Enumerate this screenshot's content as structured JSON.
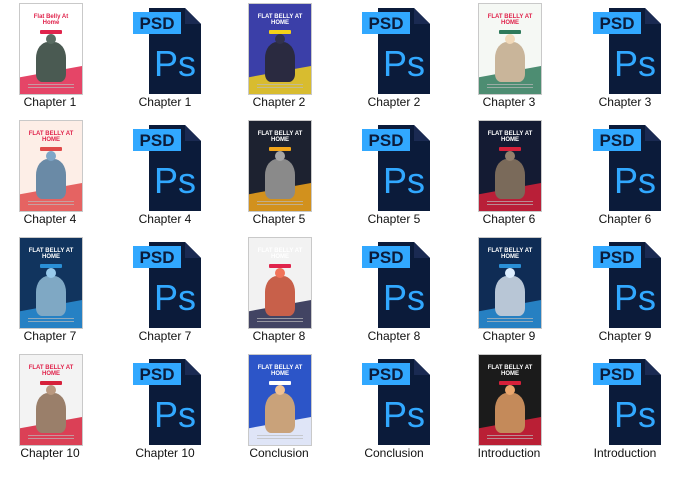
{
  "items": [
    {
      "label": "Chapter 1",
      "type": "cover",
      "cover": {
        "bg": "#ffffff",
        "accent": "#e0244c",
        "title": "Flat Belly At Home",
        "badge": "#e0244c",
        "person": "#4a5a52",
        "dark": true
      }
    },
    {
      "label": "Chapter 1",
      "type": "psd",
      "psd_text": "PSD",
      "ps_text": "Ps"
    },
    {
      "label": "Chapter 2",
      "type": "cover",
      "cover": {
        "bg": "#3b3fa8",
        "accent": "#f4d21a",
        "title": "FLAT BELLY AT HOME",
        "badge": "#f4d21a",
        "person": "#2a2a40",
        "dark": false
      }
    },
    {
      "label": "Chapter 2",
      "type": "psd",
      "psd_text": "PSD",
      "ps_text": "Ps"
    },
    {
      "label": "Chapter 3",
      "type": "cover",
      "cover": {
        "bg": "#f5f8f4",
        "accent": "#2f7a5b",
        "title": "FLAT BELLY AT HOME",
        "badge": "#2f7a5b",
        "person": "#c9b59a",
        "dark": true
      }
    },
    {
      "label": "Chapter 3",
      "type": "psd",
      "psd_text": "PSD",
      "ps_text": "Ps"
    },
    {
      "label": "Chapter 4",
      "type": "cover",
      "cover": {
        "bg": "#fdeee7",
        "accent": "#e04a4a",
        "title": "FLAT BELLY AT HOME",
        "badge": "#e04a4a",
        "person": "#6a8aa6",
        "dark": true
      }
    },
    {
      "label": "Chapter 4",
      "type": "psd",
      "psd_text": "PSD",
      "ps_text": "Ps"
    },
    {
      "label": "Chapter 5",
      "type": "cover",
      "cover": {
        "bg": "#1d2230",
        "accent": "#f2a51a",
        "title": "FLAT BELLY AT HOME",
        "badge": "#f2a51a",
        "person": "#8a8a8a",
        "dark": false
      }
    },
    {
      "label": "Chapter 5",
      "type": "psd",
      "psd_text": "PSD",
      "ps_text": "Ps"
    },
    {
      "label": "Chapter 6",
      "type": "cover",
      "cover": {
        "bg": "#141b33",
        "accent": "#d6203a",
        "title": "FLAT BELLY AT HOME",
        "badge": "#d6203a",
        "person": "#7a6a5a",
        "dark": false
      }
    },
    {
      "label": "Chapter 6",
      "type": "psd",
      "psd_text": "PSD",
      "ps_text": "Ps"
    },
    {
      "label": "Chapter 7",
      "type": "cover",
      "cover": {
        "bg": "#11345e",
        "accent": "#2a8fd6",
        "title": "FLAT BELLY AT HOME",
        "badge": "#2a8fd6",
        "person": "#7fa8c4",
        "dark": false
      }
    },
    {
      "label": "Chapter 7",
      "type": "psd",
      "psd_text": "PSD",
      "ps_text": "Ps"
    },
    {
      "label": "Chapter 8",
      "type": "cover",
      "cover": {
        "bg": "#f2f2f2",
        "accent": "#23264a",
        "title": "FLAT BELLY AT HOME",
        "badge": "#e0244c",
        "person": "#c8604a",
        "dark": false
      }
    },
    {
      "label": "Chapter 8",
      "type": "psd",
      "psd_text": "PSD",
      "ps_text": "Ps"
    },
    {
      "label": "Chapter 9",
      "type": "cover",
      "cover": {
        "bg": "#0f2c55",
        "accent": "#2a8fd6",
        "title": "FLAT BELLY AT HOME",
        "badge": "#2a8fd6",
        "person": "#b8c6d6",
        "dark": false
      }
    },
    {
      "label": "Chapter 9",
      "type": "psd",
      "psd_text": "PSD",
      "ps_text": "Ps"
    },
    {
      "label": "Chapter 10",
      "type": "cover",
      "cover": {
        "bg": "#f3f3f3",
        "accent": "#d6203a",
        "title": "FLAT BELLY AT HOME",
        "badge": "#d6203a",
        "person": "#9a7f6a",
        "dark": true
      }
    },
    {
      "label": "Chapter 10",
      "type": "psd",
      "psd_text": "PSD",
      "ps_text": "Ps"
    },
    {
      "label": "Conclusion",
      "type": "cover",
      "cover": {
        "bg": "#2c55c8",
        "accent": "#ffffff",
        "title": "FLAT BELLY AT HOME",
        "badge": "#ffffff",
        "person": "#c9a27a",
        "dark": false
      }
    },
    {
      "label": "Conclusion",
      "type": "psd",
      "psd_text": "PSD",
      "ps_text": "Ps"
    },
    {
      "label": "Introduction",
      "type": "cover",
      "cover": {
        "bg": "#1b1b1b",
        "accent": "#d6203a",
        "title": "FLAT BELLY AT HOME",
        "badge": "#d6203a",
        "person": "#c48a5a",
        "dark": false
      }
    },
    {
      "label": "Introduction",
      "type": "psd",
      "psd_text": "PSD",
      "ps_text": "Ps"
    }
  ],
  "colors": {
    "psd_tab": "#31a8ff",
    "ps_body": "#0b1b3a",
    "ps_text": "#31a8ff",
    "fold": "#1a2a52"
  }
}
